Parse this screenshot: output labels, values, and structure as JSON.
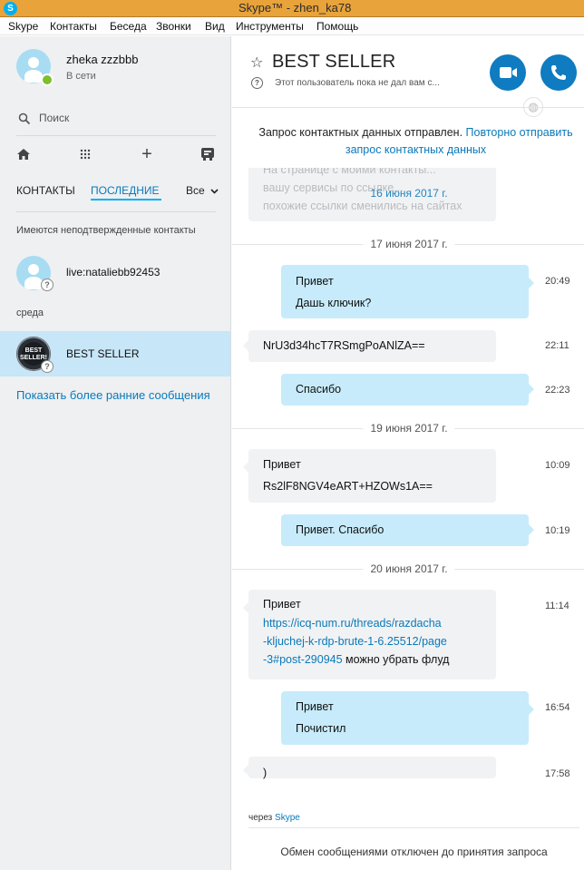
{
  "window": {
    "title": "Skype™ - zhen_ka78",
    "app_icon": "skype-logo-icon"
  },
  "menu": [
    "Skype",
    "Контакты",
    "Беседа",
    "Звонки",
    "Вид",
    "Инструменты",
    "Помощь"
  ],
  "profile": {
    "name": "zheka zzzbbb",
    "status": "В сети",
    "status_color": "#7dbf2e"
  },
  "search": {
    "placeholder": "Поиск"
  },
  "toolbar": {
    "icons": [
      "home-icon",
      "dialpad-icon",
      "add-icon",
      "contacts-book-icon"
    ],
    "add_glyph": "+"
  },
  "tabs": {
    "contacts": "КОНТАКТЫ",
    "recent": "ПОСЛЕДНИЕ",
    "filter": "Все"
  },
  "sections": {
    "unconfirmed": "Имеются неподтвержденные контакты",
    "wednesday": "среда"
  },
  "contacts": [
    {
      "name": "live:nataliebb92453",
      "status": "pending"
    },
    {
      "name": "BEST SELLER",
      "status": "pending",
      "selected": true,
      "avatar_text": "BEST SELLER!"
    }
  ],
  "show_more": "Показать более ранние сообщения",
  "chat": {
    "title": "BEST SELLER",
    "subtitle": "Этот пользователь пока не дал вам с...",
    "request_sent": "Запрос контактных данных отправлен.",
    "request_resend": "Повторно отправить запрос контактных данных"
  },
  "faded_lines": [
    "На странице с моими контакты...",
    "вашу сервисы по ссылке...",
    "похожие ссылки сменились на сайтах"
  ],
  "dates": [
    "16 июня 2017 г.",
    "17 июня 2017 г.",
    "19 июня 2017 г.",
    "20 июня 2017 г."
  ],
  "messages": [
    {
      "dir": "out",
      "lines": [
        "Привет",
        "Дашь ключик?"
      ],
      "time": "20:49"
    },
    {
      "dir": "in",
      "lines": [
        "NrU3d34hcT7RSmgPoANlZA=="
      ],
      "time": "22:11"
    },
    {
      "dir": "out",
      "lines": [
        "Спасибо"
      ],
      "time": "22:23"
    },
    {
      "dir": "in",
      "lines": [
        "Привет",
        "Rs2lF8NGV4eART+HZOWs1A=="
      ],
      "time": "10:09"
    },
    {
      "dir": "out",
      "lines": [
        "Привет. Спасибо"
      ],
      "time": "10:19"
    },
    {
      "dir": "in",
      "lines": [
        "Привет",
        "https://icq-num.ru/threads/razdacha",
        "-kljuchej-k-rdp-brute-1-6.25512/page",
        "-3#post-290945",
        " можно убрать флуд"
      ],
      "time": "11:14"
    },
    {
      "dir": "out",
      "lines": [
        "Привет",
        "Почистил"
      ],
      "time": "16:54"
    },
    {
      "dir": "in",
      "lines": [
        ")"
      ],
      "time": "17:58"
    }
  ],
  "footer": {
    "via_prefix": "через",
    "via_link": "Skype",
    "notice": "Обмен сообщениями отключен до принятия запроса"
  },
  "colors": {
    "accent": "#00aff0",
    "link": "#0a79b9",
    "selected_row": "#c7e6f7",
    "outgoing_bubble": "#c7ebfb",
    "call_button": "#0f7bc0"
  }
}
